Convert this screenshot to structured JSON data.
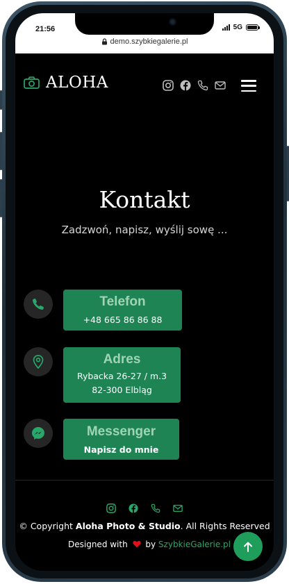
{
  "status_bar": {
    "time": "21:56",
    "network": "5G",
    "battery": 1.0
  },
  "browser": {
    "url": "demo.szybkiegalerie.pl"
  },
  "header": {
    "logo_text": "ALOHA"
  },
  "hero": {
    "title": "Kontakt",
    "subtitle": "Zadzwoń, napisz, wyślij sowę ..."
  },
  "contacts": [
    {
      "title": "Telefon",
      "lines": [
        "+48 665 86 86 88"
      ],
      "icon": "phone-icon"
    },
    {
      "title": "Adres",
      "lines": [
        "Rybacka 26-27 / m.3",
        "82-300 Elbląg"
      ],
      "icon": "map-pin-icon"
    },
    {
      "title": "Messenger",
      "lines": [
        "Napisz do mnie"
      ],
      "icon": "messenger-icon"
    }
  ],
  "footer": {
    "copyright_prefix": "© Copyright ",
    "copyright_brand": "Aloha Photo & Studio",
    "copyright_suffix": ". All Rights Reserved",
    "designed_prefix": "Designed with",
    "designed_by": "by",
    "designed_link": "SzybkieGalerie.pl"
  },
  "colors": {
    "accent": "#1e8454",
    "accent_light": "#9fd4b6",
    "icon_green": "#29a66a",
    "background": "#000000",
    "heart": "#e0101b"
  }
}
